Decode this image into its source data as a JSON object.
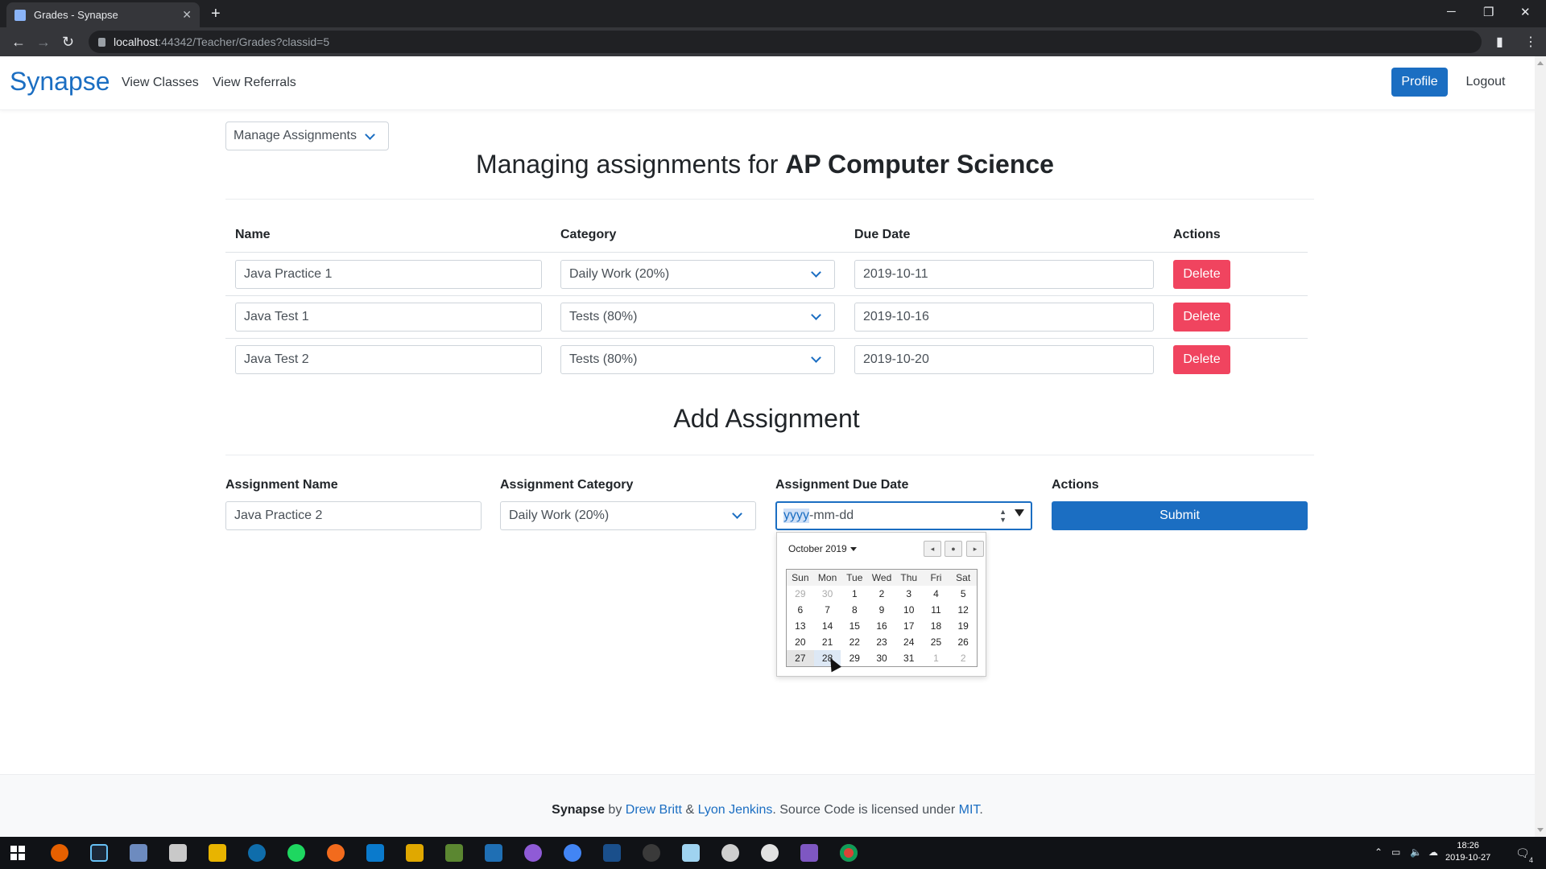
{
  "browser": {
    "tab_title": "Grades - Synapse",
    "tab_close": "✕",
    "new_tab": "+",
    "url_host": "localhost",
    "url_rest": ":44342/Teacher/Grades?classid=5"
  },
  "nav": {
    "brand": "Synapse",
    "links": [
      "View Classes",
      "View Referrals"
    ],
    "profile": "Profile",
    "logout": "Logout"
  },
  "manage_dropdown": "Manage Assignments",
  "title": {
    "prefix": "Managing assignments for ",
    "class_name": "AP Computer Science"
  },
  "table": {
    "headers": [
      "Name",
      "Category",
      "Due Date",
      "Actions"
    ],
    "rows": [
      {
        "name": "Java Practice 1",
        "category": "Daily Work (20%)",
        "due": "2019-10-11",
        "action": "Delete"
      },
      {
        "name": "Java Test 1",
        "category": "Tests (80%)",
        "due": "2019-10-16",
        "action": "Delete"
      },
      {
        "name": "Java Test 2",
        "category": "Tests (80%)",
        "due": "2019-10-20",
        "action": "Delete"
      }
    ]
  },
  "add": {
    "title": "Add Assignment",
    "labels": {
      "name": "Assignment Name",
      "category": "Assignment Category",
      "due": "Assignment Due Date",
      "actions": "Actions"
    },
    "name_value": "Java Practice 2",
    "category_value": "Daily Work (20%)",
    "date_selected_segment": "yyyy",
    "date_rest": "-mm-dd",
    "submit": "Submit"
  },
  "calendar": {
    "month": "October 2019",
    "weekdays": [
      "Sun",
      "Mon",
      "Tue",
      "Wed",
      "Thu",
      "Fri",
      "Sat"
    ],
    "weeks": [
      [
        "29",
        "30",
        "1",
        "2",
        "3",
        "4",
        "5"
      ],
      [
        "6",
        "7",
        "8",
        "9",
        "10",
        "11",
        "12"
      ],
      [
        "13",
        "14",
        "15",
        "16",
        "17",
        "18",
        "19"
      ],
      [
        "20",
        "21",
        "22",
        "23",
        "24",
        "25",
        "26"
      ],
      [
        "27",
        "28",
        "29",
        "30",
        "31",
        "1",
        "2"
      ]
    ],
    "today": "27",
    "hovered": "28"
  },
  "footer": {
    "brand": "Synapse",
    "by": " by ",
    "author1": "Drew Britt",
    "amp": " & ",
    "author2": "Lyon Jenkins",
    "license_text": ". Source Code is licensed under ",
    "license": "MIT",
    "end": "."
  },
  "taskbar": {
    "time": "18:26",
    "date": "2019-10-27",
    "notification_count": "4"
  },
  "colors": {
    "primary": "#1b6ec2",
    "danger": "#f0445f"
  }
}
